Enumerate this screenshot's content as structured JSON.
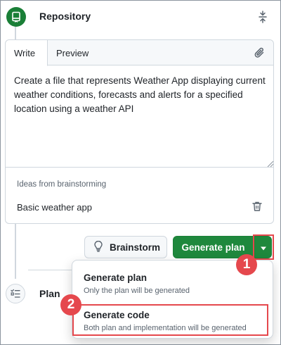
{
  "header": {
    "title": "Repository"
  },
  "editor": {
    "tabs": [
      {
        "label": "Write"
      },
      {
        "label": "Preview"
      }
    ],
    "prompt": "Create a file that represents Weather App displaying current weather conditions, forecasts and alerts for a specified location using a weather API",
    "ideas_label": "Ideas from brainstorming",
    "idea": "Basic weather app"
  },
  "actions": {
    "brainstorm_label": "Brainstorm",
    "generate_label": "Generate plan"
  },
  "dropdown": {
    "items": [
      {
        "title": "Generate plan",
        "description": "Only the plan will be generated"
      },
      {
        "title": "Generate code",
        "description": "Both plan and implementation will be generated"
      }
    ]
  },
  "plan_step": {
    "title": "Plan"
  },
  "callouts": {
    "step1": "1",
    "step2": "2"
  },
  "colors": {
    "accent_green": "#1f883d",
    "callout_red": "#e5484d",
    "border": "#d0d7de"
  }
}
